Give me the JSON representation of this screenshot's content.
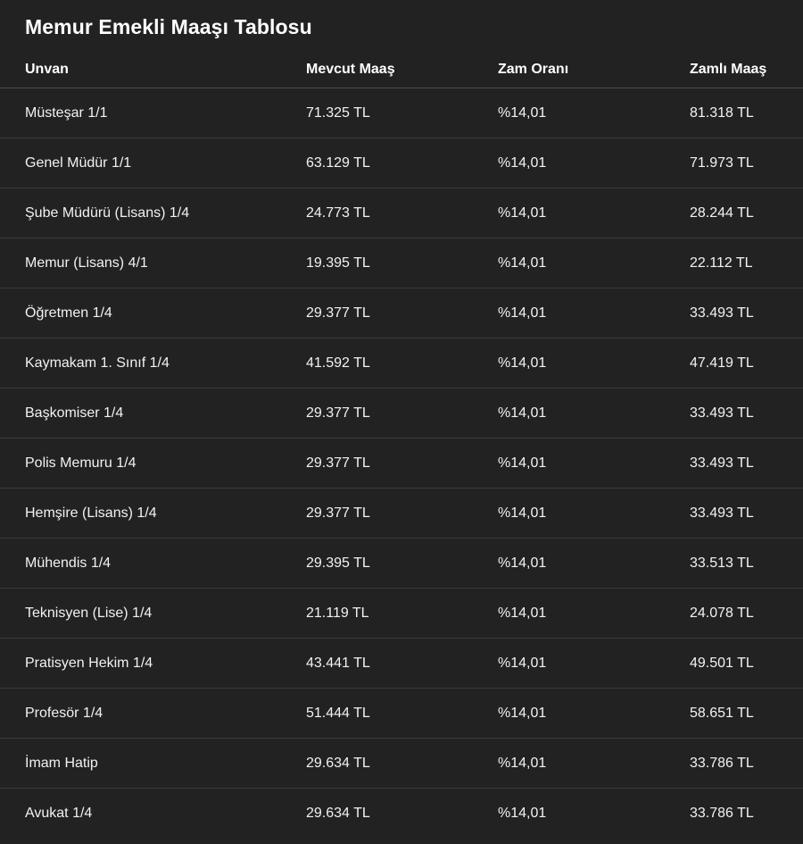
{
  "title": "Memur Emekli Maaşı Tablosu",
  "table": {
    "headers": [
      "Unvan",
      "Mevcut Maaş",
      "Zam Oranı",
      "Zamlı Maaş"
    ],
    "rows": [
      [
        "Müsteşar 1/1",
        "71.325 TL",
        "%14,01",
        "81.318 TL"
      ],
      [
        "Genel Müdür 1/1",
        "63.129 TL",
        "%14,01",
        "71.973 TL"
      ],
      [
        "Şube Müdürü (Lisans) 1/4",
        "24.773 TL",
        "%14,01",
        "28.244 TL"
      ],
      [
        "Memur (Lisans) 4/1",
        "19.395 TL",
        "%14,01",
        "22.112 TL"
      ],
      [
        "Öğretmen 1/4",
        "29.377 TL",
        "%14,01",
        "33.493 TL"
      ],
      [
        "Kaymakam 1. Sınıf 1/4",
        "41.592 TL",
        "%14,01",
        "47.419 TL"
      ],
      [
        "Başkomiser 1/4",
        "29.377 TL",
        "%14,01",
        "33.493 TL"
      ],
      [
        "Polis Memuru 1/4",
        "29.377 TL",
        "%14,01",
        "33.493 TL"
      ],
      [
        "Hemşire (Lisans) 1/4",
        "29.377 TL",
        "%14,01",
        "33.493 TL"
      ],
      [
        "Mühendis 1/4",
        "29.395 TL",
        "%14,01",
        "33.513 TL"
      ],
      [
        "Teknisyen (Lise) 1/4",
        "21.119 TL",
        "%14,01",
        "24.078 TL"
      ],
      [
        "Pratisyen Hekim 1/4",
        "43.441 TL",
        "%14,01",
        "49.501 TL"
      ],
      [
        "Profesör 1/4",
        "51.444 TL",
        "%14,01",
        "58.651 TL"
      ],
      [
        "İmam Hatip",
        "29.634 TL",
        "%14,01",
        "33.786 TL"
      ],
      [
        "Avukat 1/4",
        "29.634 TL",
        "%14,01",
        "33.786 TL"
      ]
    ]
  },
  "colors": {
    "background": "#222222",
    "text": "#ffffff",
    "divider": "#3a3a3a"
  }
}
